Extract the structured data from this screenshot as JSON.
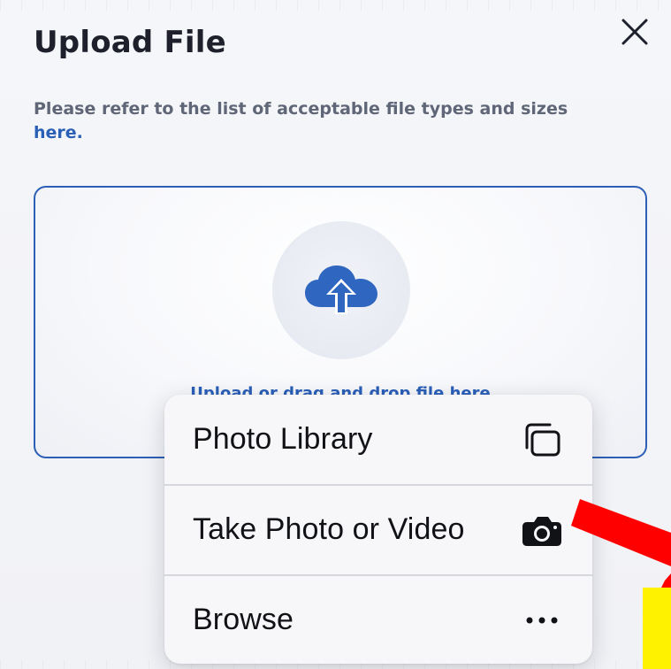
{
  "dialog": {
    "title": "Upload File",
    "info_text": "Please refer to the list of acceptable file types and sizes",
    "info_link": "here."
  },
  "dropzone": {
    "text": "Upload or drag and drop file here",
    "icon": "cloud-upload-icon"
  },
  "menu": {
    "items": [
      {
        "label": "Photo Library",
        "icon": "photo-library-icon"
      },
      {
        "label": "Take Photo or Video",
        "icon": "camera-icon"
      },
      {
        "label": "Browse",
        "icon": "ellipsis-icon"
      }
    ]
  },
  "colors": {
    "accent": "#2d5fb6",
    "link": "#2a5fb8",
    "annotation_arrow": "#ff0000",
    "annotation_box": "#fff200"
  }
}
